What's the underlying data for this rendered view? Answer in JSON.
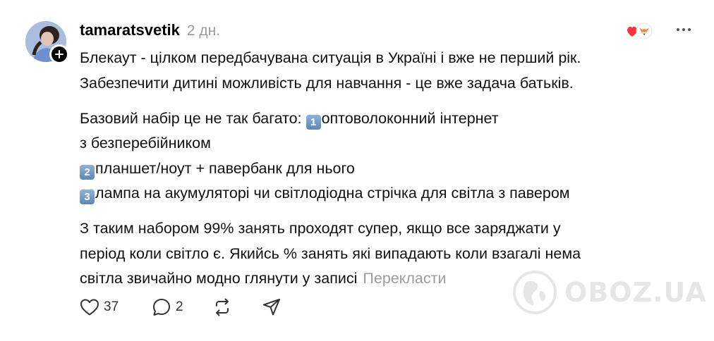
{
  "post": {
    "username": "tamaratsvetik",
    "timestamp": "2 дн.",
    "avatar_icon": "user-avatar",
    "follow_icon": "plus-icon",
    "reaction_icons": [
      "heart-icon",
      "fox-icon"
    ],
    "more_icon": "more-horizontal-icon",
    "paragraph1": {
      "line1": "Блекаут - цілком передбачувана ситуація в Україні і вже не перший рік.",
      "line2": "Забезпечити дитині можливість для навчання - це вже задача батьків."
    },
    "paragraph2": {
      "line1_text": "Базовий набір це не так багато: ",
      "item1_num": "1",
      "item1_text": "оптоволоконний інтернет",
      "line2": "з безперебійником",
      "item2_num": "2",
      "item2_text": "планшет/ноут + павербанк для нього",
      "item3_num": "3",
      "item3_text": "лампа на акумуляторі чи світлодіодна стрічка для світла з павером"
    },
    "paragraph3": {
      "line1": "З таким набором 99% занять проходят супер, якщо все заряджати у",
      "line2": "період коли світло є. Якийсь % занять які випадають коли взагалі нема",
      "line3": "світла звичайно модно глянути у записі"
    },
    "translate_label": "Перекласти"
  },
  "actions": {
    "like_count": "37",
    "reply_count": "2",
    "like_icon": "heart-outline-icon",
    "reply_icon": "comment-icon",
    "repost_icon": "repost-icon",
    "share_icon": "send-icon"
  },
  "watermark": {
    "text": "OBOZ.UA",
    "icon": "globe-hand-icon"
  },
  "colors": {
    "text": "#111111",
    "muted": "#9b9b9b",
    "keycap": "#6f97c6",
    "heart": "#ff3040"
  }
}
